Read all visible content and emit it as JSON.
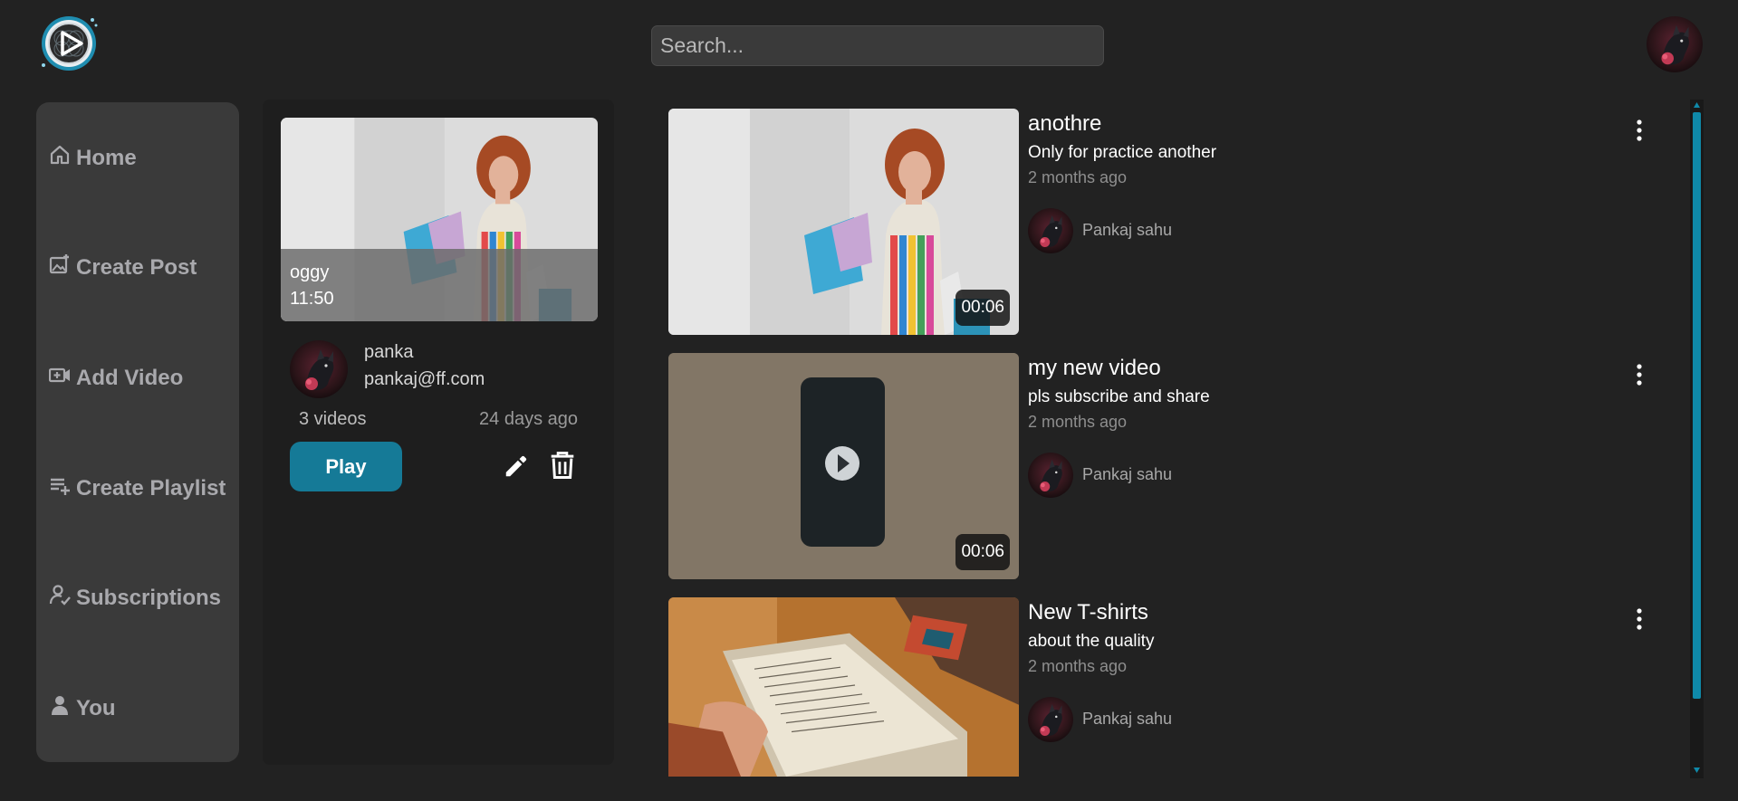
{
  "search": {
    "placeholder": "Search..."
  },
  "sidebar": {
    "items": [
      {
        "label": "Home",
        "icon": "home-icon"
      },
      {
        "label": "Create Post",
        "icon": "image-plus-icon"
      },
      {
        "label": "Add Video",
        "icon": "video-plus-icon"
      },
      {
        "label": "Create Playlist",
        "icon": "playlist-add-icon"
      },
      {
        "label": "Subscriptions",
        "icon": "user-check-icon"
      },
      {
        "label": "You",
        "icon": "user-icon"
      }
    ]
  },
  "playlist": {
    "name": "oggy",
    "time": "11:50",
    "owner_name": "panka",
    "owner_email": "pankaj@ff.com",
    "video_count": "3 videos",
    "age": "24 days ago",
    "play_label": "Play"
  },
  "videos": [
    {
      "title": "anothre",
      "description": "Only for practice another",
      "age": "2 months ago",
      "author": "Pankaj sahu",
      "duration": "00:06"
    },
    {
      "title": "my new video",
      "description": "pls subscribe and share",
      "age": "2 months ago",
      "author": "Pankaj sahu",
      "duration": "00:06"
    },
    {
      "title": "New T-shirts",
      "description": "about the quality",
      "age": "2 months ago",
      "author": "Pankaj sahu",
      "duration": ""
    }
  ],
  "colors": {
    "accent": "#157a97",
    "scrollbar": "#0f89a9",
    "background": "#222222",
    "sidebar": "#3a3a3a"
  }
}
